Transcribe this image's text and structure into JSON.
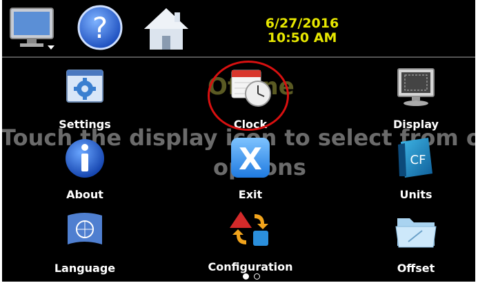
{
  "topbar": {
    "date": "6/27/2016",
    "time": "10:50 AM",
    "icons": [
      "monitor-dropdown-icon",
      "help-icon",
      "home-icon"
    ]
  },
  "background": {
    "status": "Offline",
    "message_line1": "Touch the display icon to select from offline",
    "message_line2": "options"
  },
  "tiles": [
    {
      "label": "Settings",
      "icon": "settings-window-icon"
    },
    {
      "label": "Clock",
      "icon": "calendar-clock-icon"
    },
    {
      "label": "Display",
      "icon": "display-icon"
    },
    {
      "label": "About",
      "icon": "info-icon"
    },
    {
      "label": "Exit",
      "icon": "exit-x-icon"
    },
    {
      "label": "Units",
      "icon": "units-cf-icon"
    },
    {
      "label": "Language",
      "icon": "un-flag-icon"
    },
    {
      "label": "Configuration",
      "icon": "configuration-shapes-icon"
    },
    {
      "label": "Offset",
      "icon": "folder-icon"
    }
  ],
  "pager": {
    "pages": 2,
    "current": 1
  },
  "colors": {
    "datetime": "#e8e800",
    "highlight": "#d81010",
    "background": "#000000"
  }
}
